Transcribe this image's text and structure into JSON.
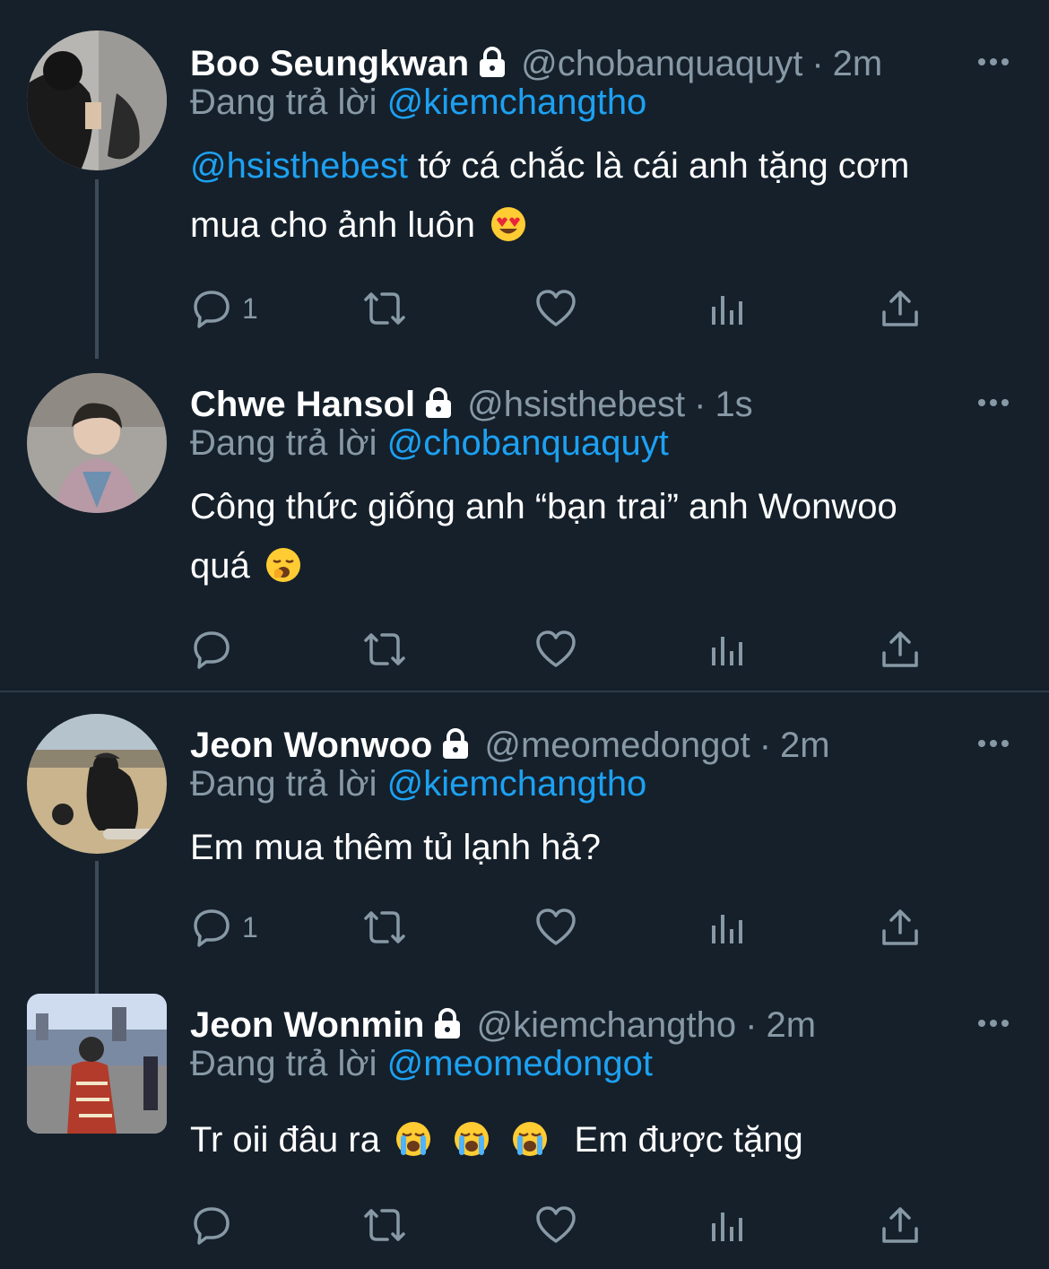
{
  "tweets": [
    {
      "name": "Boo Seungkwan",
      "handle": "@chobanquaquyt",
      "dot": "·",
      "time": "2m",
      "replying_prefix": "Đang trả lời ",
      "replying_to": "@kiemchangtho",
      "body_mention": "@hsisthebest",
      "body_line1": " tớ cá chắc là cái anh tặng cơm",
      "body_line2": "mua cho ảnh luôn",
      "emoji": "heart-eyes-emoji",
      "reply_count": "1"
    },
    {
      "name": "Chwe Hansol",
      "handle": "@hsisthebest",
      "dot": "·",
      "time": "1s",
      "replying_prefix": "Đang trả lời ",
      "replying_to": "@chobanquaquyt",
      "body_line1": "Công thức giống anh “bạn trai” anh Wonwoo",
      "body_line2": "quá",
      "emoji": "yawning-emoji",
      "reply_count": ""
    },
    {
      "name": "Jeon Wonwoo",
      "handle": "@meomedongot",
      "dot": "·",
      "time": "2m",
      "replying_prefix": "Đang trả lời ",
      "replying_to": "@kiemchangtho",
      "body_line1": "Em mua thêm tủ lạnh hả?",
      "reply_count": "1"
    },
    {
      "name": "Jeon Wonmin",
      "handle": "@kiemchangtho",
      "dot": "·",
      "time": "2m",
      "replying_prefix": "Đang trả lời ",
      "replying_to": "@meomedongot",
      "body_before": "Tr oii đâu ra",
      "body_after": "Em được tặng",
      "emoji": "loudly-crying-emoji",
      "reply_count": ""
    }
  ],
  "colors": {
    "background": "#15202b",
    "text": "#ffffff",
    "secondary": "#8899a6",
    "mention": "#1da1f2",
    "thread_line": "#3d4b59"
  },
  "icons": [
    "reply-icon",
    "retweet-icon",
    "like-icon",
    "analytics-icon",
    "share-icon",
    "lock-icon",
    "more-icon"
  ]
}
